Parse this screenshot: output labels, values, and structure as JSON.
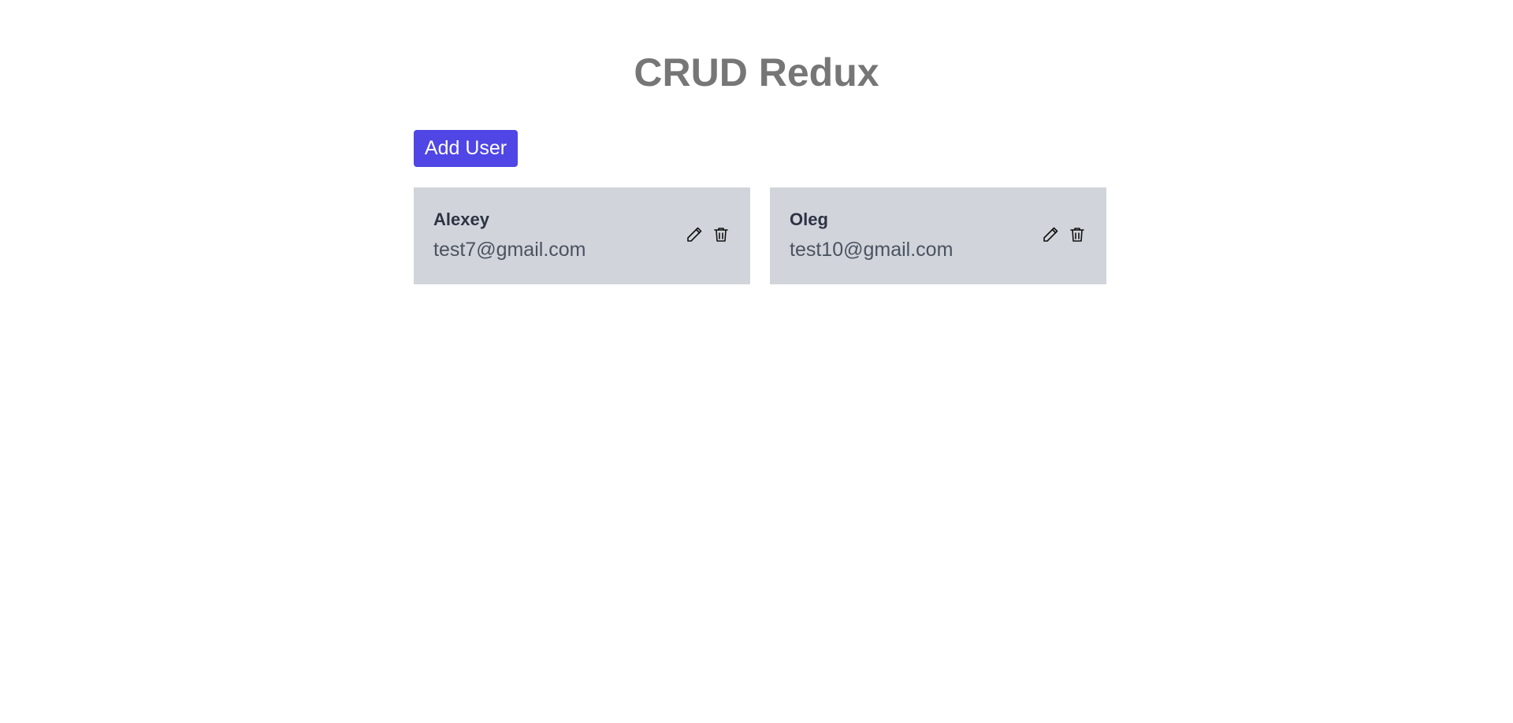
{
  "header": {
    "title": "CRUD Redux"
  },
  "toolbar": {
    "add_user_label": "Add User"
  },
  "users": [
    {
      "name": "Alexey",
      "email": "test7@gmail.com",
      "edit_icon": "pencil-icon",
      "delete_icon": "trash-icon"
    },
    {
      "name": "Oleg",
      "email": "test10@gmail.com",
      "edit_icon": "pencil-icon",
      "delete_icon": "trash-icon"
    }
  ],
  "colors": {
    "accent": "#4f46e5",
    "card_background": "#d1d5db",
    "title": "#767676",
    "name_text": "#2d3343",
    "email_text": "#4b5260"
  }
}
